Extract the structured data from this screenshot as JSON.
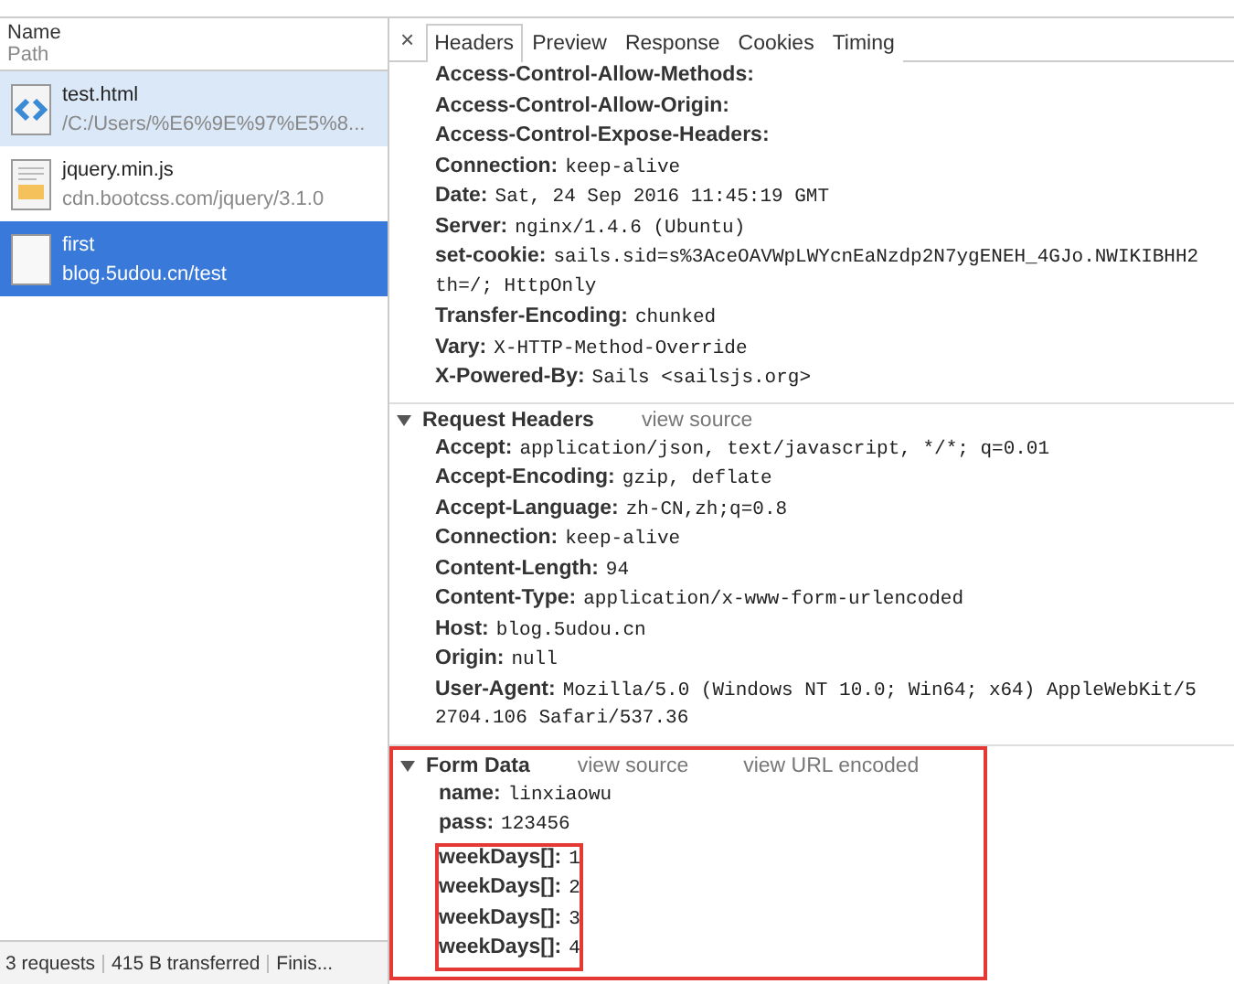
{
  "requests_panel": {
    "columns": [
      "Name",
      "Path"
    ],
    "requests": [
      {
        "name": "test.html",
        "path": "/C:/Users/%E6%9E%97%E5%8...",
        "kind": "html",
        "selected": false,
        "hovered": true
      },
      {
        "name": "jquery.min.js",
        "path": "cdn.bootcss.com/jquery/3.1.0",
        "kind": "js",
        "selected": false,
        "hovered": false
      },
      {
        "name": "first",
        "path": "blog.5udou.cn/test",
        "kind": "document",
        "selected": true,
        "hovered": false
      }
    ],
    "status_bar": [
      "3 requests",
      "415 B transferred",
      "Finis..."
    ]
  },
  "detail_panel": {
    "close": "×",
    "tabs": [
      {
        "label": "Headers",
        "selected": true
      },
      {
        "label": "Preview",
        "selected": false
      },
      {
        "label": "Response",
        "selected": false
      },
      {
        "label": "Cookies",
        "selected": false
      },
      {
        "label": "Timing",
        "selected": false
      }
    ],
    "sections": [
      {
        "highlighted": false,
        "items": [
          {
            "key": "Access-Control-Allow-Methods:",
            "value": null,
            "highlighted": false
          },
          {
            "key": "Access-Control-Allow-Origin:",
            "value": null,
            "highlighted": false
          },
          {
            "key": "Access-Control-Expose-Headers:",
            "value": null,
            "highlighted": false
          },
          {
            "key": "Connection:",
            "value": "keep-alive",
            "highlighted": false
          },
          {
            "key": "Date:",
            "value": "Sat, 24 Sep 2016 11:45:19 GMT",
            "highlighted": false
          },
          {
            "key": "Server:",
            "value": "nginx/1.4.6 (Ubuntu)",
            "highlighted": false
          },
          {
            "key": "set-cookie:",
            "value": "sails.sid=s%3AceOAVWpLWYcnEaNzdp2N7ygENEH_4GJo.NWIKIBHH2",
            "continuation": "th=/; HttpOnly",
            "highlighted": false
          },
          {
            "key": "Transfer-Encoding:",
            "value": "chunked",
            "highlighted": false
          },
          {
            "key": "Vary:",
            "value": "X-HTTP-Method-Override",
            "highlighted": false
          },
          {
            "key": "X-Powered-By:",
            "value": "Sails <sailsjs.org>",
            "highlighted": false
          }
        ]
      },
      {
        "title": "Request Headers",
        "links": [
          "view source"
        ],
        "highlighted": false,
        "items": [
          {
            "key": "Accept:",
            "value": "application/json, text/javascript, */*; q=0.01",
            "highlighted": false
          },
          {
            "key": "Accept-Encoding:",
            "value": "gzip, deflate",
            "highlighted": false
          },
          {
            "key": "Accept-Language:",
            "value": "zh-CN,zh;q=0.8",
            "highlighted": false
          },
          {
            "key": "Connection:",
            "value": "keep-alive",
            "highlighted": false
          },
          {
            "key": "Content-Length:",
            "value": "94",
            "highlighted": false
          },
          {
            "key": "Content-Type:",
            "value": "application/x-www-form-urlencoded",
            "highlighted": false
          },
          {
            "key": "Host:",
            "value": "blog.5udou.cn",
            "highlighted": false
          },
          {
            "key": "Origin:",
            "value": "null",
            "highlighted": false
          },
          {
            "key": "User-Agent:",
            "value": "Mozilla/5.0 (Windows NT 10.0; Win64; x64) AppleWebKit/5",
            "continuation": "2704.106 Safari/537.36",
            "highlighted": false
          }
        ]
      },
      {
        "title": "Form Data",
        "links": [
          "view source",
          "view URL encoded"
        ],
        "highlighted": true,
        "items": [
          {
            "key": "name:",
            "value": "linxiaowu",
            "highlighted": false
          },
          {
            "key": "pass:",
            "value": "123456",
            "highlighted": false
          },
          {
            "key": "weekDays[]:",
            "value": "1",
            "highlighted": true
          },
          {
            "key": "weekDays[]:",
            "value": "2",
            "highlighted": true
          },
          {
            "key": "weekDays[]:",
            "value": "3",
            "highlighted": true
          },
          {
            "key": "weekDays[]:",
            "value": "4",
            "highlighted": true
          }
        ]
      }
    ]
  }
}
